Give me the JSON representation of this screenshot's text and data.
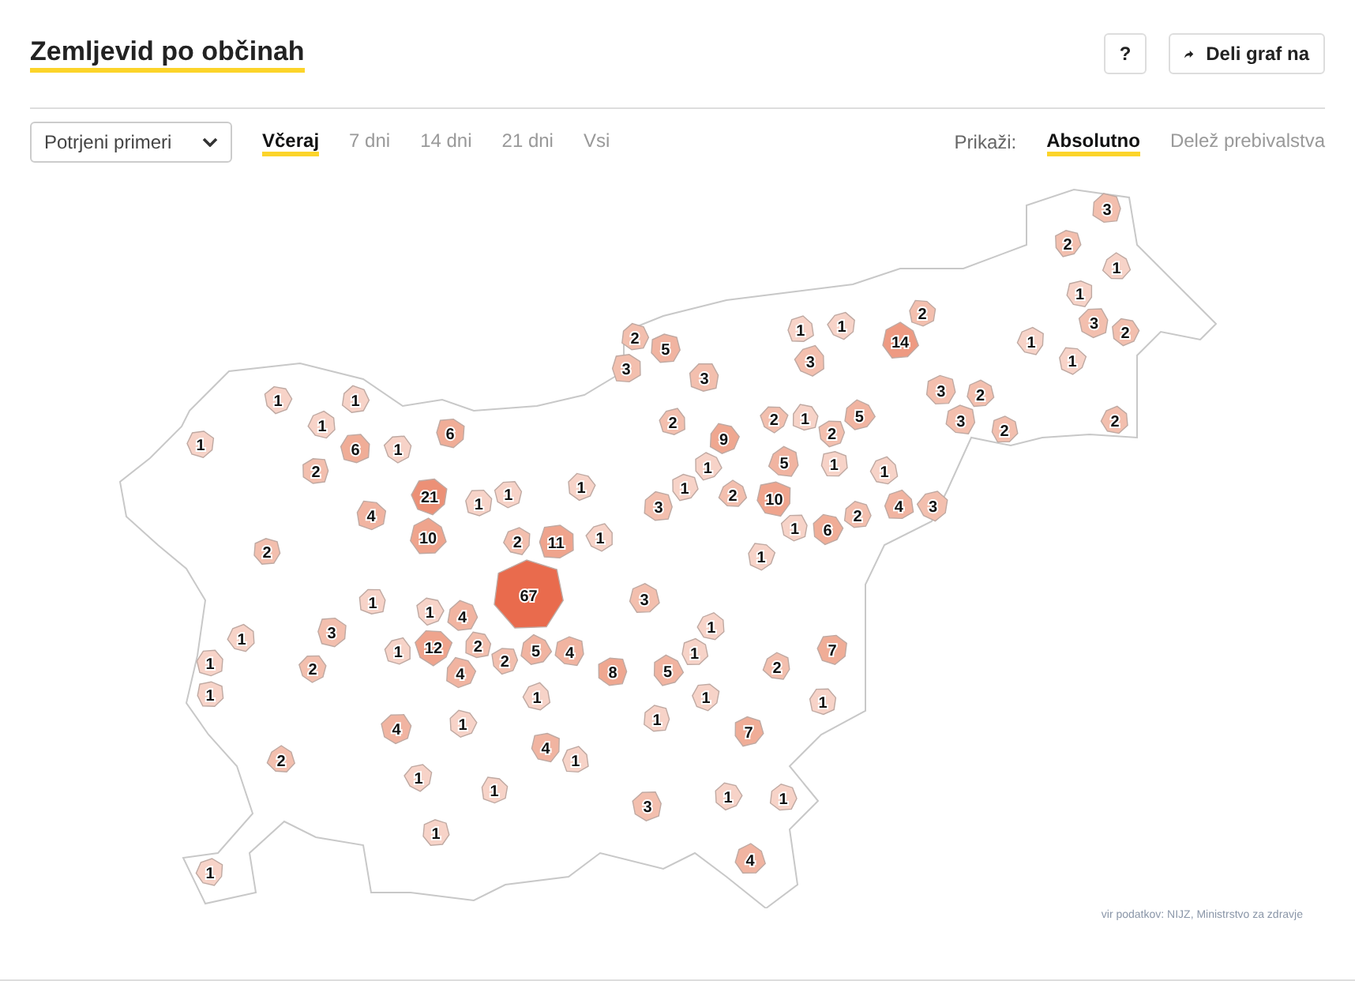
{
  "title": "Zemljevid po občinah",
  "header_buttons": [
    {
      "kind": "help",
      "label": "?"
    },
    {
      "kind": "share",
      "label": "Deli graf na"
    }
  ],
  "metric_select": {
    "value": "Potrjeni primeri"
  },
  "periods": [
    {
      "label": "Včeraj",
      "selected": true
    },
    {
      "label": "7 dni",
      "selected": false
    },
    {
      "label": "14 dni",
      "selected": false
    },
    {
      "label": "21 dni",
      "selected": false
    },
    {
      "label": "Vsi",
      "selected": false
    }
  ],
  "display": {
    "label": "Prikaži:",
    "options": [
      {
        "label": "Absolutno",
        "selected": true
      },
      {
        "label": "Delež prebivalstva",
        "selected": false
      }
    ]
  },
  "map": {
    "municipalities": [
      {
        "value": "3",
        "color": "#f3bfae"
      },
      {
        "value": "2",
        "color": "#f3bfae"
      },
      {
        "value": "1",
        "color": "#f7d3c8"
      },
      {
        "value": "1",
        "color": "#f7d3c8"
      },
      {
        "value": "1",
        "color": "#f7d3c8"
      },
      {
        "value": "1",
        "color": "#f7d3c8"
      },
      {
        "value": "2",
        "color": "#f3bfae"
      },
      {
        "value": "3",
        "color": "#f3bfae"
      },
      {
        "value": "2",
        "color": "#f3bfae"
      },
      {
        "value": "2",
        "color": "#f3bfae"
      },
      {
        "value": "5",
        "color": "#f1b4a1"
      },
      {
        "value": "14",
        "color": "#ee9a82"
      },
      {
        "value": "1",
        "color": "#f7d3c8"
      },
      {
        "value": "3",
        "color": "#f3bfae"
      },
      {
        "value": "3",
        "color": "#f3bfae"
      },
      {
        "value": "1",
        "color": "#f7d3c8"
      },
      {
        "value": "3",
        "color": "#f3bfae"
      },
      {
        "value": "1",
        "color": "#f7d3c8"
      },
      {
        "value": "1",
        "color": "#f7d3c8"
      },
      {
        "value": "3",
        "color": "#f3bfae"
      },
      {
        "value": "2",
        "color": "#f3bfae"
      },
      {
        "value": "1",
        "color": "#f7d3c8"
      },
      {
        "value": "6",
        "color": "#f0ad97"
      },
      {
        "value": "2",
        "color": "#f3bfae"
      },
      {
        "value": "2",
        "color": "#f3bfae"
      },
      {
        "value": "1",
        "color": "#f7d3c8"
      },
      {
        "value": "2",
        "color": "#f3bfae"
      },
      {
        "value": "5",
        "color": "#f1b4a1"
      },
      {
        "value": "3",
        "color": "#f3bfae"
      },
      {
        "value": "2",
        "color": "#f3bfae"
      },
      {
        "value": "2",
        "color": "#f3bfae"
      },
      {
        "value": "1",
        "color": "#f7d3c8"
      },
      {
        "value": "6",
        "color": "#f0ad97"
      },
      {
        "value": "1",
        "color": "#f7d3c8"
      },
      {
        "value": "9",
        "color": "#efa790"
      },
      {
        "value": "2",
        "color": "#f3bfae"
      },
      {
        "value": "1",
        "color": "#f7d3c8"
      },
      {
        "value": "5",
        "color": "#f1b4a1"
      },
      {
        "value": "1",
        "color": "#f7d3c8"
      },
      {
        "value": "1",
        "color": "#f7d3c8"
      },
      {
        "value": "21",
        "color": "#ec9076"
      },
      {
        "value": "1",
        "color": "#f7d3c8"
      },
      {
        "value": "1",
        "color": "#f7d3c8"
      },
      {
        "value": "1",
        "color": "#f7d3c8"
      },
      {
        "value": "3",
        "color": "#f3bfae"
      },
      {
        "value": "1",
        "color": "#f7d3c8"
      },
      {
        "value": "2",
        "color": "#f3bfae"
      },
      {
        "value": "10",
        "color": "#efa48d"
      },
      {
        "value": "4",
        "color": "#f1b4a1"
      },
      {
        "value": "3",
        "color": "#f3bfae"
      },
      {
        "value": "4",
        "color": "#f1b4a1"
      },
      {
        "value": "1",
        "color": "#f7d3c8"
      },
      {
        "value": "6",
        "color": "#f0ad97"
      },
      {
        "value": "2",
        "color": "#f3bfae"
      },
      {
        "value": "2",
        "color": "#f3bfae"
      },
      {
        "value": "10",
        "color": "#efa48d"
      },
      {
        "value": "2",
        "color": "#f3bfae"
      },
      {
        "value": "11",
        "color": "#efa48d"
      },
      {
        "value": "1",
        "color": "#f7d3c8"
      },
      {
        "value": "1",
        "color": "#f7d3c8"
      },
      {
        "value": "1",
        "color": "#f7d3c8"
      },
      {
        "value": "1",
        "color": "#f7d3c8"
      },
      {
        "value": "4",
        "color": "#f1b4a1"
      },
      {
        "value": "67",
        "color": "#e96b4d"
      },
      {
        "value": "3",
        "color": "#f3bfae"
      },
      {
        "value": "1",
        "color": "#f7d3c8"
      },
      {
        "value": "3",
        "color": "#f3bfae"
      },
      {
        "value": "1",
        "color": "#f7d3c8"
      },
      {
        "value": "12",
        "color": "#efa48d"
      },
      {
        "value": "2",
        "color": "#f3bfae"
      },
      {
        "value": "2",
        "color": "#f3bfae"
      },
      {
        "value": "5",
        "color": "#f1b4a1"
      },
      {
        "value": "4",
        "color": "#f1b4a1"
      },
      {
        "value": "1",
        "color": "#f7d3c8"
      },
      {
        "value": "1",
        "color": "#f7d3c8"
      },
      {
        "value": "7",
        "color": "#f0ad97"
      },
      {
        "value": "1",
        "color": "#f7d3c8"
      },
      {
        "value": "2",
        "color": "#f3bfae"
      },
      {
        "value": "4",
        "color": "#f1b4a1"
      },
      {
        "value": "8",
        "color": "#efa790"
      },
      {
        "value": "5",
        "color": "#f1b4a1"
      },
      {
        "value": "2",
        "color": "#f3bfae"
      },
      {
        "value": "1",
        "color": "#f7d3c8"
      },
      {
        "value": "1",
        "color": "#f7d3c8"
      },
      {
        "value": "1",
        "color": "#f7d3c8"
      },
      {
        "value": "1",
        "color": "#f7d3c8"
      },
      {
        "value": "4",
        "color": "#f1b4a1"
      },
      {
        "value": "1",
        "color": "#f7d3c8"
      },
      {
        "value": "1",
        "color": "#f7d3c8"
      },
      {
        "value": "7",
        "color": "#f0ad97"
      },
      {
        "value": "2",
        "color": "#f3bfae"
      },
      {
        "value": "4",
        "color": "#f1b4a1"
      },
      {
        "value": "1",
        "color": "#f7d3c8"
      },
      {
        "value": "1",
        "color": "#f7d3c8"
      },
      {
        "value": "1",
        "color": "#f7d3c8"
      },
      {
        "value": "3",
        "color": "#f3bfae"
      },
      {
        "value": "1",
        "color": "#f7d3c8"
      },
      {
        "value": "1",
        "color": "#f7d3c8"
      },
      {
        "value": "1",
        "color": "#f7d3c8"
      },
      {
        "value": "4",
        "color": "#f1b4a1"
      },
      {
        "value": "1",
        "color": "#f7d3c8"
      }
    ]
  },
  "source": "vir podatkov: NIJZ, Ministrstvo za zdravje"
}
